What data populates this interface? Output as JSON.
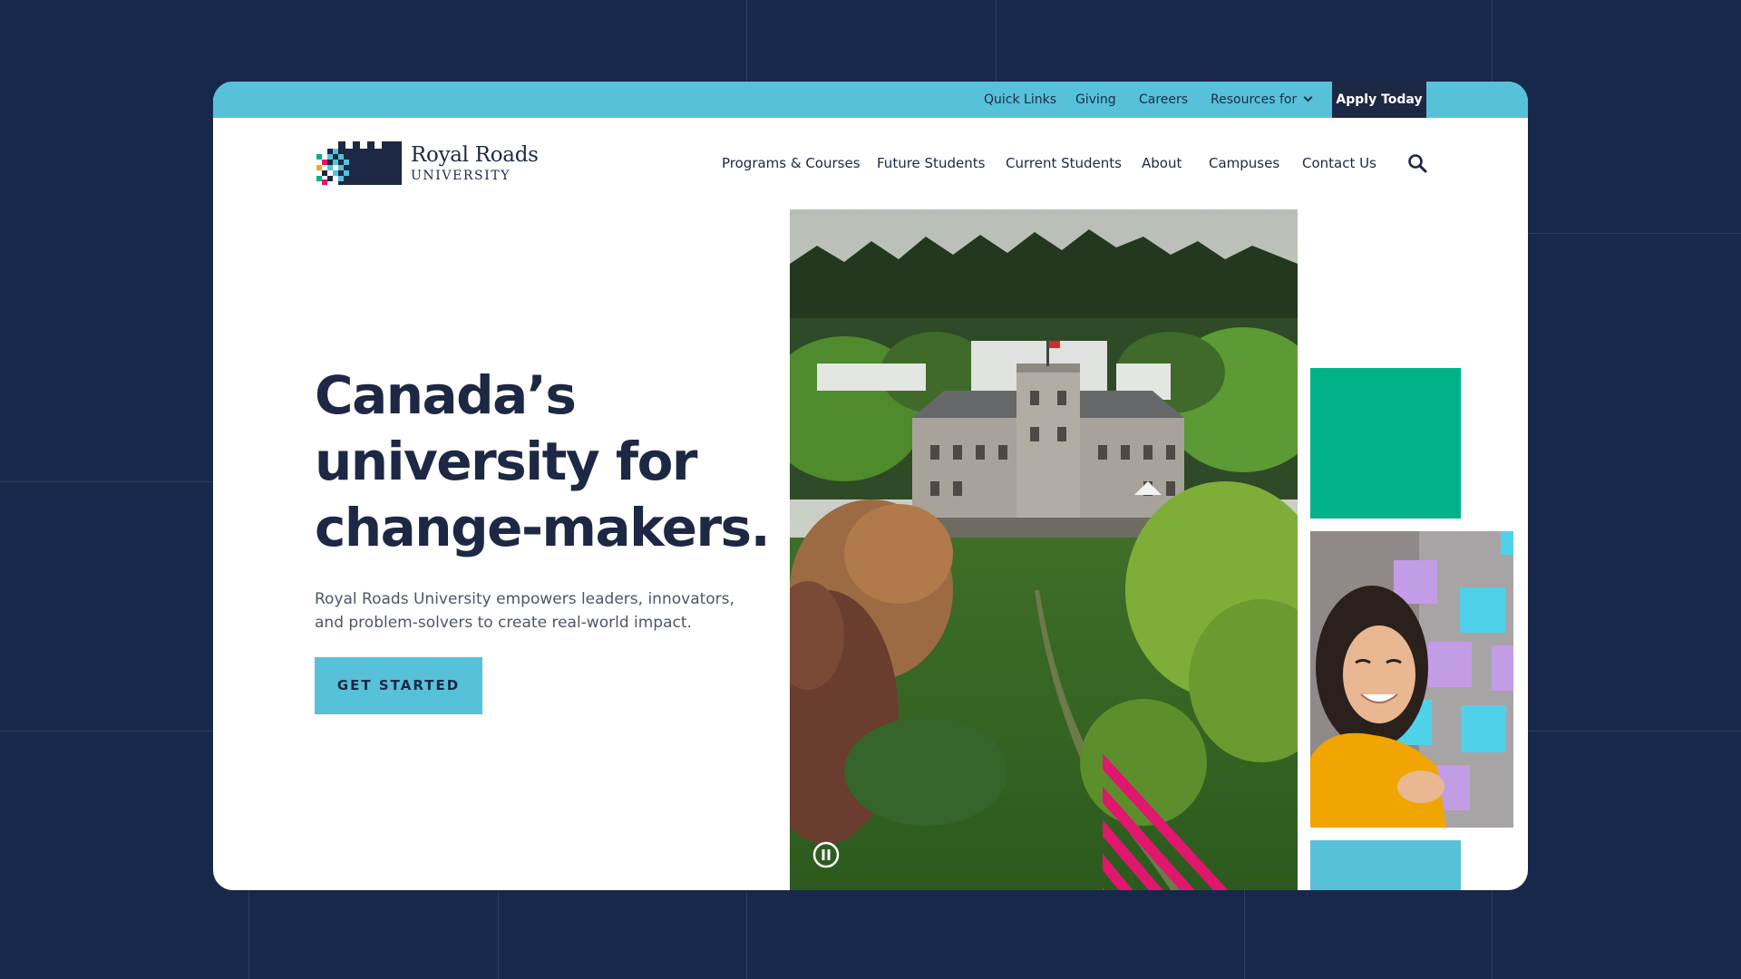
{
  "utility_nav": {
    "quick_links": "Quick Links",
    "giving": "Giving",
    "careers": "Careers",
    "resources_for": "Resources for",
    "apply_today": "Apply Today"
  },
  "logo": {
    "name": "Royal Roads",
    "subtitle": "UNIVERSITY"
  },
  "main_nav": {
    "items": [
      "Programs & Courses",
      "Future Students",
      "Current Students",
      "About",
      "Campuses",
      "Contact Us"
    ],
    "search_icon": "search-icon"
  },
  "hero": {
    "headline": "Canada’s university for change-makers.",
    "description": "Royal Roads University empowers leaders, innovators, and problem-solvers to create real-world impact.",
    "cta_label": "GET STARTED",
    "pause_icon": "pause-icon"
  },
  "colors": {
    "page_background": "#18284a",
    "utility_bar": "#56c1d9",
    "navy": "#1c2844",
    "accent_green": "#00b287",
    "accent_pink": "#e0166f",
    "accent_blue": "#56c1d9"
  }
}
